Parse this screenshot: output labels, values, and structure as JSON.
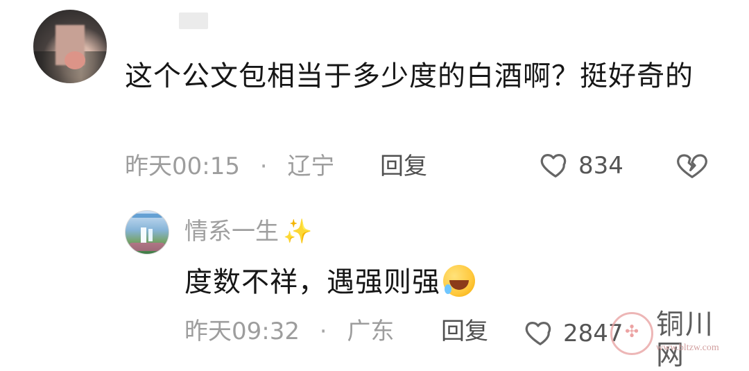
{
  "top_comment": {
    "text": "这个公文包相当于多少度的白酒啊？挺好奇的",
    "time": "昨天00:15",
    "separator": "·",
    "location": "辽宁",
    "reply_label": "回复",
    "likes": "834"
  },
  "reply_comment": {
    "username": "情系一生",
    "username_suffix": "✨",
    "text": "度数不祥，遇强则强",
    "time": "昨天09:32",
    "separator": "·",
    "location": "广东",
    "reply_label": "回复",
    "likes": "2847"
  },
  "watermark": {
    "name": "铜川网",
    "url": "www.bltzw.com"
  },
  "icons": {
    "like": "heart-outline-icon",
    "dislike": "broken-heart-icon",
    "sparkle": "sparkles-icon",
    "emoji": "laugh-tears-emoji"
  }
}
